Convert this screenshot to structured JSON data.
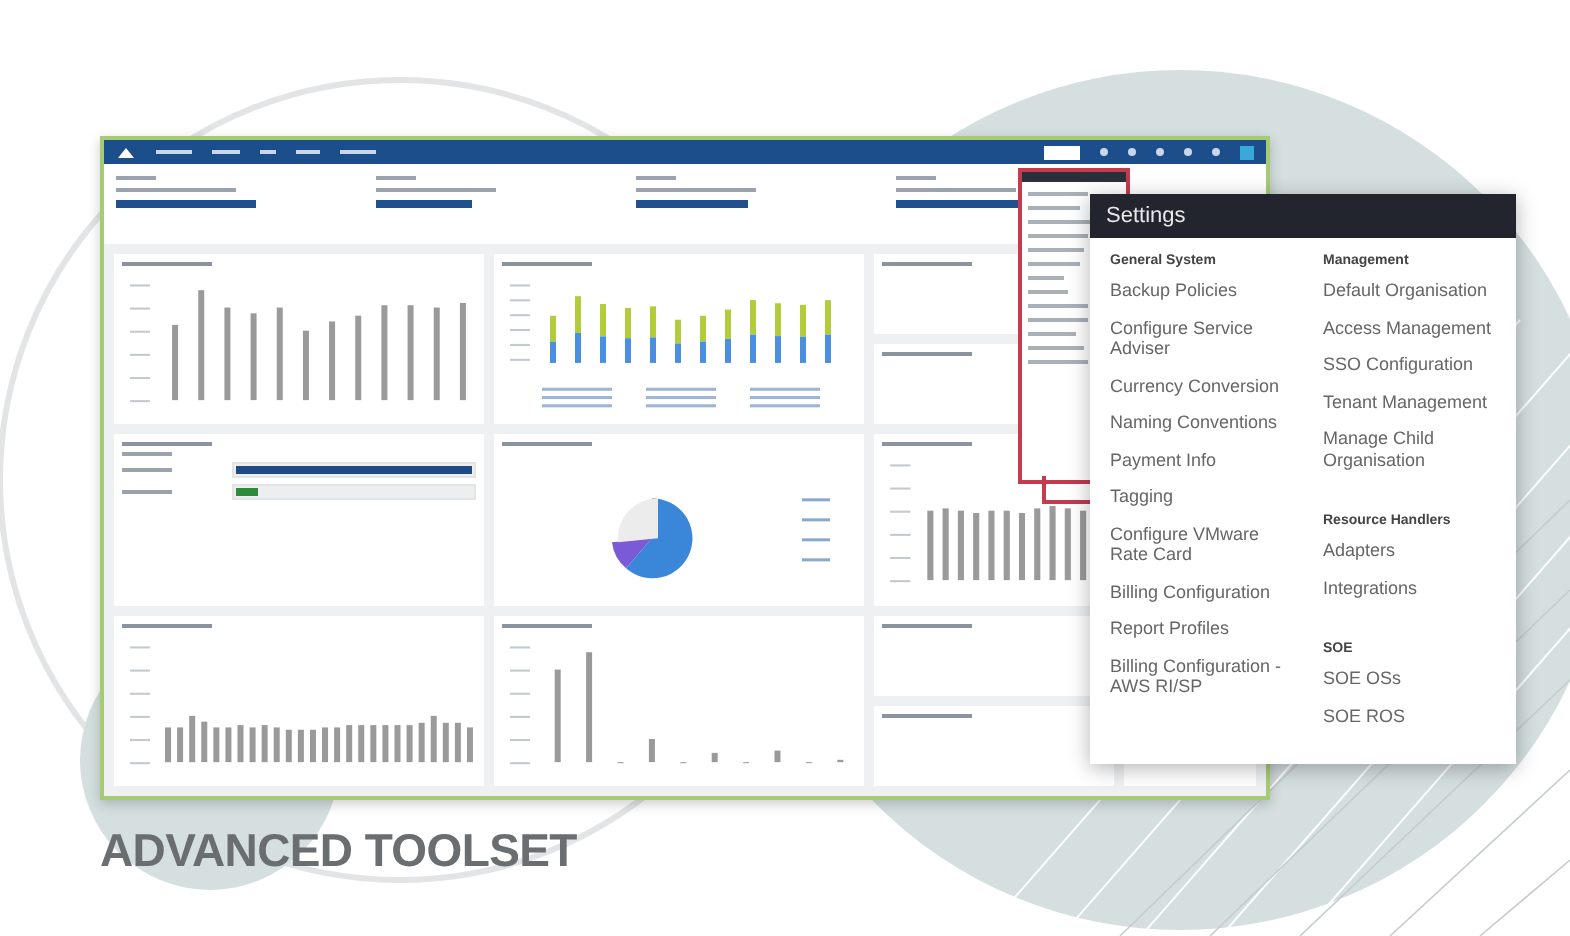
{
  "settings": {
    "title": "Settings",
    "columns": [
      {
        "sections": [
          {
            "heading": "General System",
            "items": [
              "Backup Policies",
              "Configure Service Adviser",
              "Currency Conversion",
              "Naming Conventions",
              "Payment Info",
              "Tagging",
              "Configure VMware Rate Card",
              "Billing Configuration",
              "Report Profiles",
              "Billing Configuration - AWS RI/SP"
            ]
          }
        ]
      },
      {
        "sections": [
          {
            "heading": "Management",
            "items": [
              "Default Organisation",
              "Access Management",
              "SSO Configuration",
              "Tenant Management",
              "Manage Child Organisation"
            ]
          },
          {
            "heading": "Resource Handlers",
            "items": [
              "Adapters",
              "Integrations"
            ]
          },
          {
            "heading": "SOE",
            "items": [
              "SOE OSs",
              "SOE ROS"
            ]
          }
        ]
      }
    ]
  },
  "budget": {
    "bars": [
      {
        "level": 1
      },
      {
        "level": 0.09
      }
    ]
  },
  "caption": "ADVANCED TOOLSET"
}
